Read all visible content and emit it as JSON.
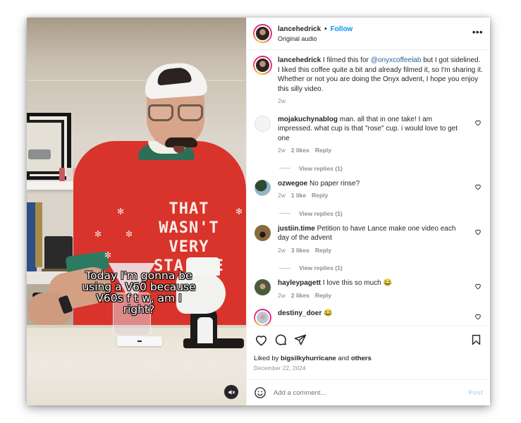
{
  "post": {
    "author": "lancehedrick",
    "follow_label": "Follow",
    "separator": "•",
    "audio": "Original audio",
    "more_label": "•••"
  },
  "video": {
    "caption_lines": [
      "Today I'm gonna be",
      "using a V60 because",
      "V60s f t w, am I",
      "right?"
    ],
    "sweater_lines": [
      "THAT",
      "WASN'T",
      "VERY",
      "STA-B_E"
    ],
    "muted": true
  },
  "caption": {
    "user": "lancehedrick",
    "text_before": " I filmed this for ",
    "mention": "@onyxcoffeelab",
    "text_after": " but I got sidelined. I liked this coffee quite a bit and already filmed it, so I'm sharing it.",
    "text_line2": "Whether or not you are doing the Onyx advent, I hope you enjoy this silly video.",
    "time": "2w"
  },
  "comments": [
    {
      "user": "mojakuchynablog",
      "text": " man. all that in one take! I am impressed. what cup is that \"rose\" cup. i would love to get one",
      "time": "2w",
      "likes": "2 likes",
      "reply": "Reply",
      "view_replies": "View replies (1)",
      "avatar_color": "#f4f4f4"
    },
    {
      "user": "ozwegoe",
      "text": " No paper rinse?",
      "time": "2w",
      "likes": "1 like",
      "reply": "Reply",
      "view_replies": "View replies (1)",
      "avatar_color": "#3f6a58"
    },
    {
      "user": "justiin.time",
      "text": " Petition to have Lance make one video each day of the advent",
      "time": "2w",
      "likes": "3 likes",
      "reply": "Reply",
      "view_replies": "View replies (1)",
      "avatar_color": "#7a5a35"
    },
    {
      "user": "hayleypagett",
      "text": " I love this so much 😂",
      "time": "2w",
      "likes": "2 likes",
      "reply": "Reply",
      "view_replies": null,
      "avatar_color": "#5d6a4c"
    },
    {
      "user": "destiny_doer",
      "text": " 😂",
      "time": null,
      "likes": null,
      "reply": null,
      "view_replies": null,
      "avatar_color": "#c9d3e6"
    }
  ],
  "actions": {
    "liked_by_prefix": "Liked by ",
    "liked_by_user": "bigsilkyhurricane",
    "liked_by_mid": " and ",
    "liked_by_suffix": "others",
    "date": "December 22, 2024"
  },
  "add_comment": {
    "placeholder": "Add a comment...",
    "post_label": "Post"
  },
  "colors": {
    "follow_blue": "#0095f6",
    "post_disabled": "#b2dffc",
    "muted_text": "#8e8e8e"
  }
}
